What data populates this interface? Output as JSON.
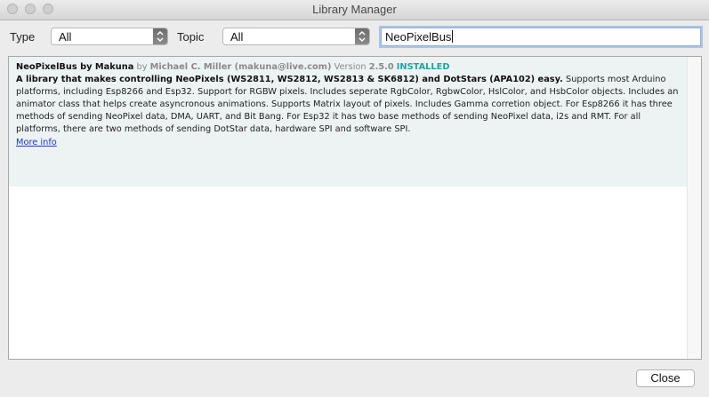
{
  "window": {
    "title": "Library Manager"
  },
  "filters": {
    "type_label": "Type",
    "type_value": "All",
    "topic_label": "Topic",
    "topic_value": "All",
    "search_value": "NeoPixelBus"
  },
  "library": {
    "name": "NeoPixelBus by Makuna",
    "by": "by",
    "author": "Michael C. Miller (makuna@live.com)",
    "version_label": "Version",
    "version": "2.5.0",
    "status": "INSTALLED",
    "summary": "A library that makes controlling NeoPixels (WS2811, WS2812, WS2813 & SK6812) and DotStars (APA102) easy.",
    "description": "Supports most Arduino platforms, including Esp8266 and Esp32. Support for RGBW pixels. Includes seperate RgbColor, RgbwColor, HslColor, and HsbColor objects. Includes an animator class that helps create asyncronous animations. Supports Matrix layout of pixels. Includes Gamma corretion object. For Esp8266 it has three methods of sending NeoPixel data, DMA, UART, and Bit Bang. For Esp32 it has two base methods of sending NeoPixel data, i2s and RMT. For all platforms, there are two methods of sending DotStar data, hardware SPI and software SPI.",
    "more_info": "More info"
  },
  "footer": {
    "close_label": "Close"
  },
  "icons": {
    "dropdown": "updown-chevron-icon"
  }
}
